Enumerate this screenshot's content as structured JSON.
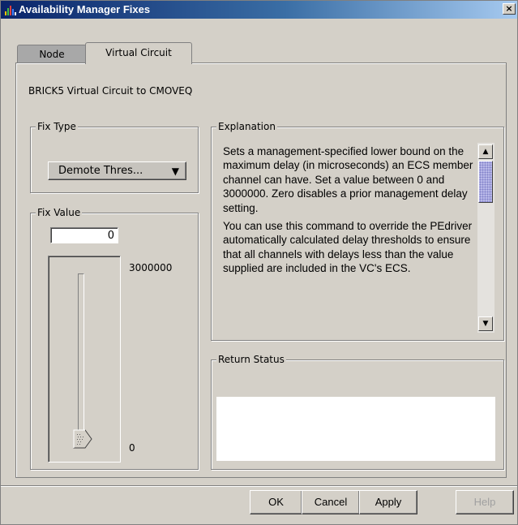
{
  "window": {
    "title": "Availability Manager Fixes",
    "close_glyph": "×"
  },
  "tabs": [
    {
      "label": "Node",
      "active": false
    },
    {
      "label": "Virtual Circuit",
      "active": true
    }
  ],
  "header": {
    "label": "BRICK5 Virtual Circuit to CMOVEQ"
  },
  "fix_type": {
    "title": "Fix Type",
    "selected": "Demote Thres...",
    "arrow": "▼"
  },
  "fix_value": {
    "title": "Fix Value",
    "value": "0",
    "slider_max": "3000000",
    "slider_min": "0",
    "slider_level": 0
  },
  "explanation": {
    "title": "Explanation",
    "paragraph1": "Sets a management-specified lower bound on the maximum delay (in microseconds) an ECS member channel can have. Set a value between 0 and 3000000. Zero disables a prior management delay setting.",
    "paragraph2": "You can use this command to override the PEdriver automatically calculated delay thresholds to ensure that all channels with delays less than the value supplied are included in the VC's ECS.",
    "scroll_up": "▲",
    "scroll_down": "▼"
  },
  "return_status": {
    "title": "Return Status",
    "text": ""
  },
  "buttons": {
    "ok": "OK",
    "cancel": "Cancel",
    "apply": "Apply",
    "help": "Help"
  },
  "icons": {
    "app_icon": "bar-chart-icon",
    "close": "close-icon",
    "dropdown": "chevron-down-icon",
    "slider_thumb": "slider-thumb-icon"
  },
  "colors": {
    "titlebar_start": "#0a246a",
    "titlebar_end": "#a6caf0",
    "dialog_bg": "#d4d0c8",
    "scroll_thumb": "#b8b8e8"
  }
}
